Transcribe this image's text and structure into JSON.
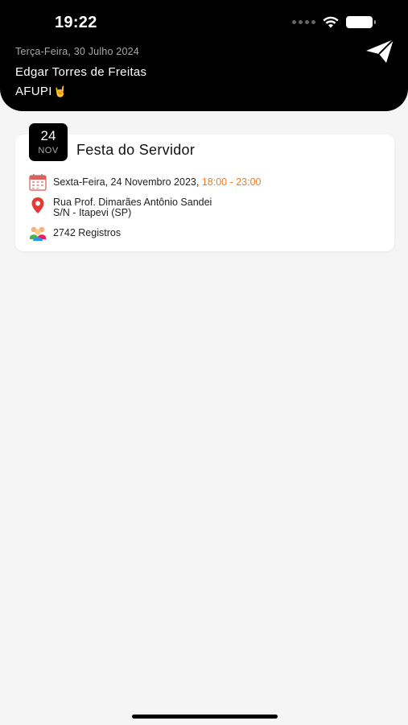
{
  "status_bar": {
    "time": "19:22"
  },
  "header": {
    "date": "Terça-Feira, 30 Julho 2024",
    "user_name": "Edgar Torres de Freitas",
    "org": "AFUPI",
    "org_emoji": "🤘"
  },
  "event": {
    "badge_day": "24",
    "badge_month": "NOV",
    "title": "Festa do Servidor",
    "date_text": "Sexta-Feira, 24 Novembro 2023, ",
    "time_range": "18:00 - 23:00",
    "address_line1": "Rua Prof. Dimarães Antônio Sandei",
    "address_line2": "S/N - Itapevi (SP)",
    "registrations": "2742 Registros"
  },
  "colors": {
    "header_bg": "#000000",
    "accent_time": "#f07b1d",
    "page_bg": "#f5f5f5",
    "pin_red": "#e53935"
  },
  "icons": {
    "calendar": "calendar-icon",
    "location": "location-pin-icon",
    "people": "people-group-icon",
    "send": "send-arrow-icon"
  }
}
